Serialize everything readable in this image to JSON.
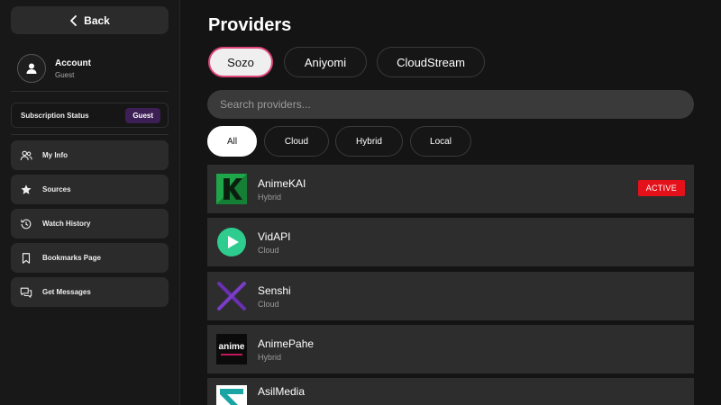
{
  "sidebar": {
    "back_label": "Back",
    "account": {
      "name": "Account",
      "status": "Guest"
    },
    "subscription": {
      "label": "Subscription Status",
      "badge": "Guest",
      "badge_color": "#3c1f54"
    },
    "items": [
      {
        "label": "My Info",
        "icon": "users-icon"
      },
      {
        "label": "Sources",
        "icon": "star-icon"
      },
      {
        "label": "Watch History",
        "icon": "history-icon"
      },
      {
        "label": "Bookmarks Page",
        "icon": "bookmark-icon"
      },
      {
        "label": "Get Messages",
        "icon": "messages-icon"
      }
    ]
  },
  "main": {
    "title": "Providers",
    "tabs": [
      {
        "label": "Sozo",
        "active": true
      },
      {
        "label": "Aniyomi",
        "active": false
      },
      {
        "label": "CloudStream",
        "active": false
      }
    ],
    "search": {
      "placeholder": "Search providers...",
      "value": ""
    },
    "filters": [
      {
        "label": "All",
        "active": true
      },
      {
        "label": "Cloud",
        "active": false
      },
      {
        "label": "Hybrid",
        "active": false
      },
      {
        "label": "Local",
        "active": false
      }
    ],
    "providers": [
      {
        "name": "AnimeKAI",
        "type": "Hybrid",
        "badge": "ACTIVE",
        "icon": "animekai-logo-icon"
      },
      {
        "name": "VidAPI",
        "type": "Cloud",
        "icon": "vidapi-play-icon"
      },
      {
        "name": "Senshi",
        "type": "Cloud",
        "icon": "senshi-x-icon"
      },
      {
        "name": "AnimePahe",
        "type": "Hybrid",
        "icon": "animepahe-logo-icon",
        "logo_text": "anime"
      },
      {
        "name": "AsilMedia",
        "type": "",
        "icon": "asilmedia-logo-icon"
      }
    ]
  },
  "colors": {
    "accent_tab_border": "#e0457b",
    "active_badge": "#e4111b",
    "background": "#141414",
    "card": "#2d2d2d"
  }
}
